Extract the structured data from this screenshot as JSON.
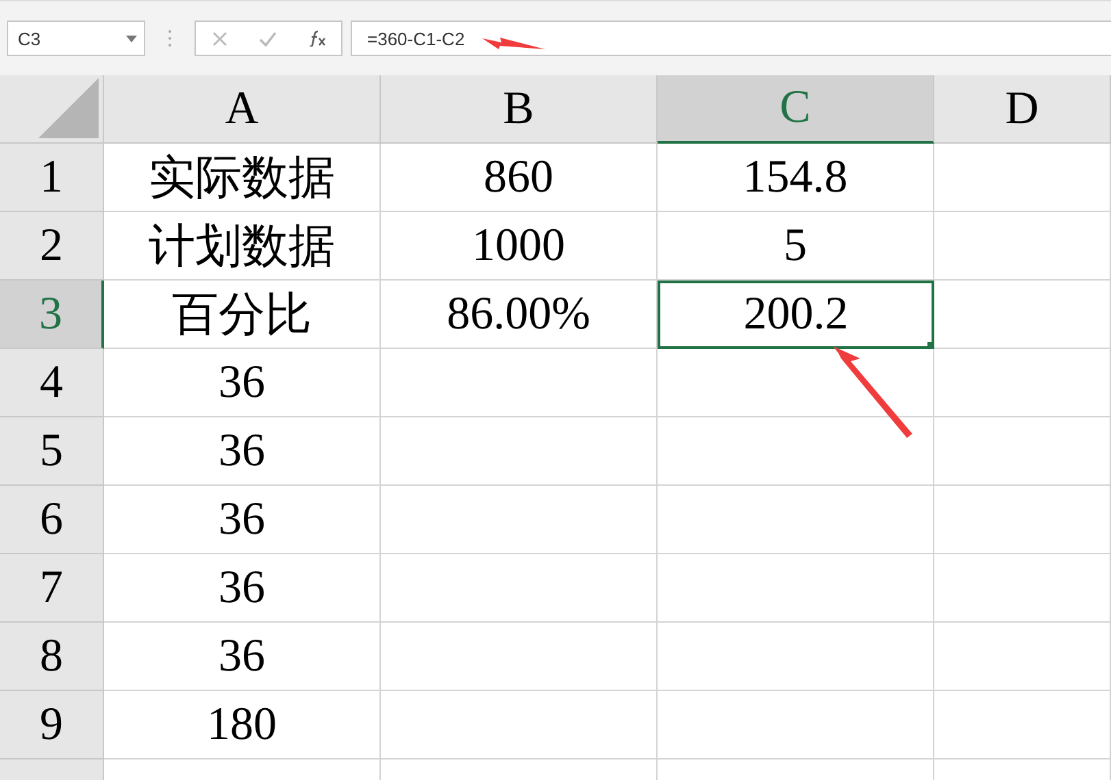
{
  "name_box": {
    "value": "C3"
  },
  "formula_bar": {
    "value": "=360-C1-C2"
  },
  "columns": [
    {
      "label": "A",
      "selected": false
    },
    {
      "label": "B",
      "selected": false
    },
    {
      "label": "C",
      "selected": true
    },
    {
      "label": "D",
      "selected": false
    }
  ],
  "rows": [
    {
      "label": "1",
      "selected": false,
      "cells": [
        {
          "text": "实际数据",
          "selected": false
        },
        {
          "text": "860",
          "selected": false
        },
        {
          "text": "154.8",
          "selected": false
        }
      ]
    },
    {
      "label": "2",
      "selected": false,
      "cells": [
        {
          "text": "计划数据",
          "selected": false
        },
        {
          "text": "1000",
          "selected": false
        },
        {
          "text": "5",
          "selected": false
        }
      ]
    },
    {
      "label": "3",
      "selected": true,
      "cells": [
        {
          "text": "百分比",
          "selected": false
        },
        {
          "text": "86.00%",
          "selected": false
        },
        {
          "text": "200.2",
          "selected": true
        }
      ]
    },
    {
      "label": "4",
      "selected": false,
      "cells": [
        {
          "text": "36",
          "selected": false
        }
      ]
    },
    {
      "label": "5",
      "selected": false,
      "cells": [
        {
          "text": "36",
          "selected": false
        }
      ]
    },
    {
      "label": "6",
      "selected": false,
      "cells": [
        {
          "text": "36",
          "selected": false
        }
      ]
    },
    {
      "label": "7",
      "selected": false,
      "cells": [
        {
          "text": "36",
          "selected": false
        }
      ]
    },
    {
      "label": "8",
      "selected": false,
      "cells": [
        {
          "text": "36",
          "selected": false
        }
      ]
    },
    {
      "label": "9",
      "selected": false,
      "cells": [
        {
          "text": "180",
          "selected": false
        }
      ]
    }
  ]
}
